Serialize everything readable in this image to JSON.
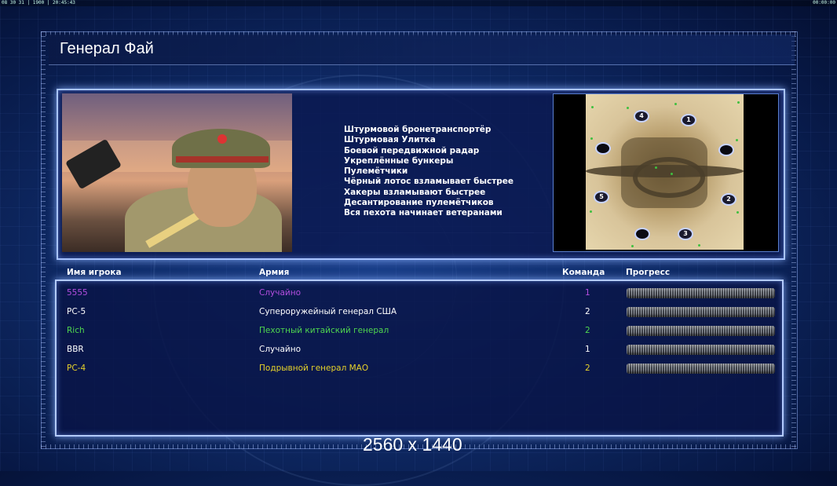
{
  "status_bar": {
    "left_text": "08 30 31 | 1900 | 20:45:43",
    "right_text": "00:00:00"
  },
  "title": "Генерал Фай",
  "features": [
    "Штурмовой бронетранспортёр",
    "Штурмовая Улитка",
    "Боевой передвижной радар",
    "Укреплённые бункеры",
    "Пулемётчики",
    "Чёрный лотос взламывает быстрее",
    "Хакеры взламывают быстрее",
    "Десантирование пулемётчиков",
    "Вся пехота начинает ветеранами"
  ],
  "map": {
    "spawn_labels": [
      "4",
      "1",
      "",
      "",
      "5",
      "2",
      "",
      "3"
    ],
    "spawn_icon": "player-start-marker",
    "resource_icon": "supply-dot"
  },
  "table": {
    "headers": {
      "name": "Имя игрока",
      "army": "Армия",
      "team": "Команда",
      "progress": "Прогресс"
    },
    "rows": [
      {
        "name": "5555",
        "army": "Случайно",
        "team": "1",
        "color": "#b44ee0",
        "progress": 1.0
      },
      {
        "name": "PC-5",
        "army": "Супероружейный генерал США",
        "team": "2",
        "color": "#ffffff",
        "progress": 1.0
      },
      {
        "name": "Rich",
        "army": "Пехотный китайский генерал",
        "team": "2",
        "color": "#4fd64f",
        "progress": 1.0
      },
      {
        "name": "BBR",
        "army": "Случайно",
        "team": "1",
        "color": "#ffffff",
        "progress": 1.0
      },
      {
        "name": "PC-4",
        "army": "Подрывной генерал МАО",
        "team": "2",
        "color": "#e6d22a",
        "progress": 1.0
      }
    ]
  },
  "resolution_text": "2560 x 1440"
}
